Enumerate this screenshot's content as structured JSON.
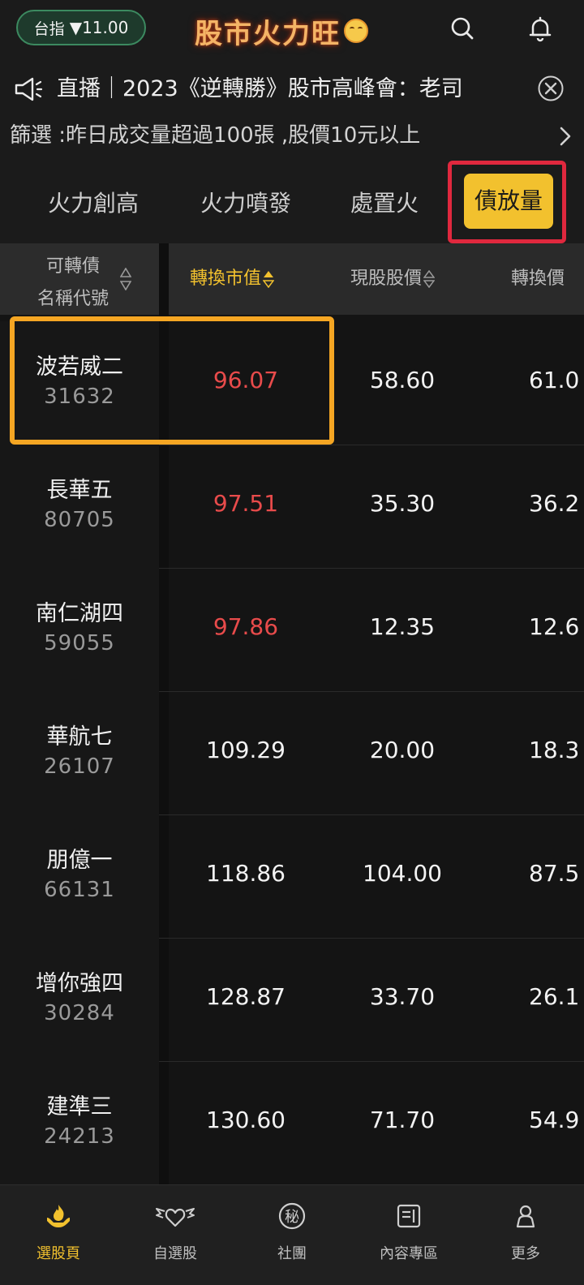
{
  "header": {
    "index_label": "台指",
    "index_value": "▼11.00",
    "brand_title": "股市火力旺"
  },
  "marquee": {
    "text": "直播｜2023《逆轉勝》股市高峰會：老司"
  },
  "filter": {
    "text": "篩選 :昨日成交量超過100張 ,股價10元以上"
  },
  "tabs": [
    {
      "label": "火力創高",
      "active": false
    },
    {
      "label": "火力噴發",
      "active": false
    },
    {
      "label": "處置火",
      "active": false
    },
    {
      "label": "債放量",
      "active": true
    }
  ],
  "table": {
    "header_name_line1": "可轉債",
    "header_name_line2": "名稱代號",
    "columns": [
      "轉換市值",
      "現股股價",
      "轉換價"
    ],
    "column_visible": [
      "轉換市值",
      "現股股價",
      "轉換價"
    ],
    "rows": [
      {
        "name": "波若威二",
        "code": "31632",
        "conv_value": "96.07",
        "price": "58.60",
        "conv_price": "61.0",
        "highlight": true
      },
      {
        "name": "長華五",
        "code": "80705",
        "conv_value": "97.51",
        "price": "35.30",
        "conv_price": "36.2",
        "highlight": true
      },
      {
        "name": "南仁湖四",
        "code": "59055",
        "conv_value": "97.86",
        "price": "12.35",
        "conv_price": "12.6",
        "highlight": true
      },
      {
        "name": "華航七",
        "code": "26107",
        "conv_value": "109.29",
        "price": "20.00",
        "conv_price": "18.3",
        "highlight": false
      },
      {
        "name": "朋億一",
        "code": "66131",
        "conv_value": "118.86",
        "price": "104.00",
        "conv_price": "87.5",
        "highlight": false
      },
      {
        "name": "增你強四",
        "code": "30284",
        "conv_value": "128.87",
        "price": "33.70",
        "conv_price": "26.1",
        "highlight": false
      },
      {
        "name": "建準三",
        "code": "24213",
        "conv_value": "130.60",
        "price": "71.70",
        "conv_price": "54.9",
        "highlight": false
      }
    ]
  },
  "bottom_nav": [
    {
      "label": "選股頁",
      "icon": "fire-hand-icon",
      "active": true
    },
    {
      "label": "自選股",
      "icon": "winged-heart-icon",
      "active": false
    },
    {
      "label": "社團",
      "icon": "secret-badge-icon",
      "active": false
    },
    {
      "label": "內容專區",
      "icon": "document-icon",
      "active": false
    },
    {
      "label": "更多",
      "icon": "person-icon",
      "active": false
    }
  ],
  "colors": {
    "accent": "#f2c12e",
    "negative": "#e84b4b",
    "frame_red": "#e0283e",
    "frame_orange": "#f5a623"
  },
  "icons": {
    "secret_glyph": "秘"
  }
}
